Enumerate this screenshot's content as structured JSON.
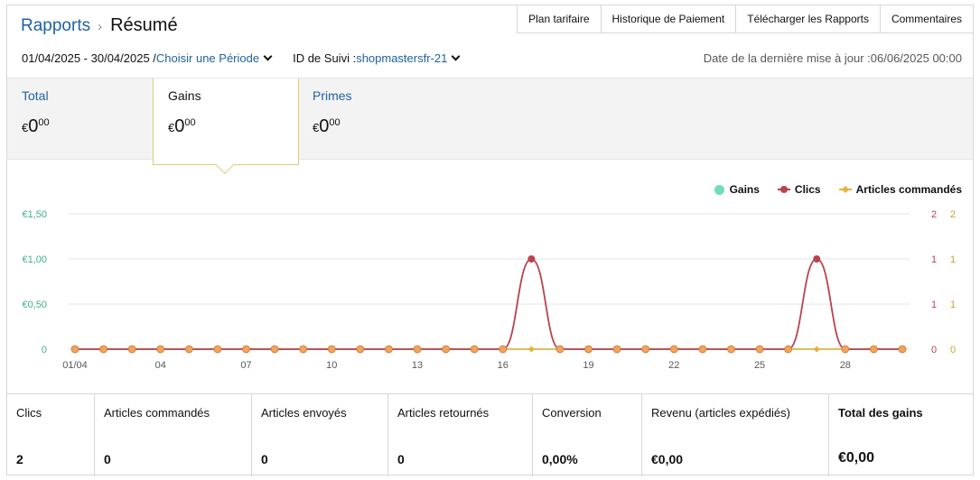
{
  "header": {
    "breadcrumb_parent": "Rapports",
    "title": "Résumé",
    "tabs": [
      "Plan tarifaire",
      "Historique de Paiement",
      "Télécharger les Rapports",
      "Commentaires"
    ]
  },
  "filters": {
    "date_range": "01/04/2025 - 30/04/2025 /",
    "period_link": "Choisir une Période",
    "tracking_label": "ID de Suivi :",
    "tracking_id": "shopmastersfr-21",
    "last_updated": "Date de la dernière mise à jour :06/06/2025 00:00"
  },
  "summary": [
    {
      "label": "Total",
      "currency": "€",
      "whole": "0",
      "cents": "00",
      "active": false
    },
    {
      "label": "Gains",
      "currency": "€",
      "whole": "0",
      "cents": "00",
      "active": true
    },
    {
      "label": "Primes",
      "currency": "€",
      "whole": "0",
      "cents": "00",
      "active": false
    }
  ],
  "colors": {
    "gains": "#6fdcbc",
    "clics": "#b8434f",
    "articles": "#e8b23a",
    "point_fill": "#f0a45c",
    "link": "#2162a1"
  },
  "chart_data": {
    "type": "line",
    "x": [
      "01/04",
      "02/04",
      "03/04",
      "04/04",
      "05/04",
      "06/04",
      "07/04",
      "08/04",
      "09/04",
      "10/04",
      "11/04",
      "12/04",
      "13/04",
      "14/04",
      "15/04",
      "16/04",
      "17/04",
      "18/04",
      "19/04",
      "20/04",
      "21/04",
      "22/04",
      "23/04",
      "24/04",
      "25/04",
      "26/04",
      "27/04",
      "28/04",
      "29/04",
      "30/04"
    ],
    "x_tick_labels": [
      "01/04",
      "04",
      "07",
      "10",
      "13",
      "16",
      "19",
      "22",
      "25",
      "28"
    ],
    "x_tick_indices": [
      0,
      3,
      6,
      9,
      12,
      15,
      18,
      21,
      24,
      27
    ],
    "series": [
      {
        "name": "Gains",
        "axis": "left",
        "values": [
          0,
          0,
          0,
          0,
          0,
          0,
          0,
          0,
          0,
          0,
          0,
          0,
          0,
          0,
          0,
          0,
          0,
          0,
          0,
          0,
          0,
          0,
          0,
          0,
          0,
          0,
          0,
          0,
          0,
          0
        ]
      },
      {
        "name": "Clics",
        "axis": "right1",
        "values": [
          0,
          0,
          0,
          0,
          0,
          0,
          0,
          0,
          0,
          0,
          0,
          0,
          0,
          0,
          0,
          0,
          1,
          0,
          0,
          0,
          0,
          0,
          0,
          0,
          0,
          0,
          1,
          0,
          0,
          0
        ]
      },
      {
        "name": "Articles commandés",
        "axis": "right2",
        "values": [
          0,
          0,
          0,
          0,
          0,
          0,
          0,
          0,
          0,
          0,
          0,
          0,
          0,
          0,
          0,
          0,
          0,
          0,
          0,
          0,
          0,
          0,
          0,
          0,
          0,
          0,
          0,
          0,
          0,
          0
        ]
      }
    ],
    "y_left_ticks": [
      "0",
      "€0,50",
      "€1,00",
      "€1,50"
    ],
    "y_right1_ticks": [
      "0",
      "1",
      "1",
      "2"
    ],
    "y_right2_ticks": [
      "0",
      "1",
      "1",
      "2"
    ],
    "ylim_left": [
      0,
      1.5
    ],
    "ylim_right": [
      0,
      1.5
    ],
    "legend_position": "top-right",
    "grid": true
  },
  "stats": [
    {
      "label": "Clics",
      "value": "2"
    },
    {
      "label": "Articles commandés",
      "value": "0"
    },
    {
      "label": "Articles envoyés",
      "value": "0"
    },
    {
      "label": "Articles retournés",
      "value": "0"
    },
    {
      "label": "Conversion",
      "value": "0,00%"
    },
    {
      "label": "Revenu (articles expédiés)",
      "value": "€0,00"
    },
    {
      "label": "Total des gains",
      "value": "€0,00"
    }
  ]
}
